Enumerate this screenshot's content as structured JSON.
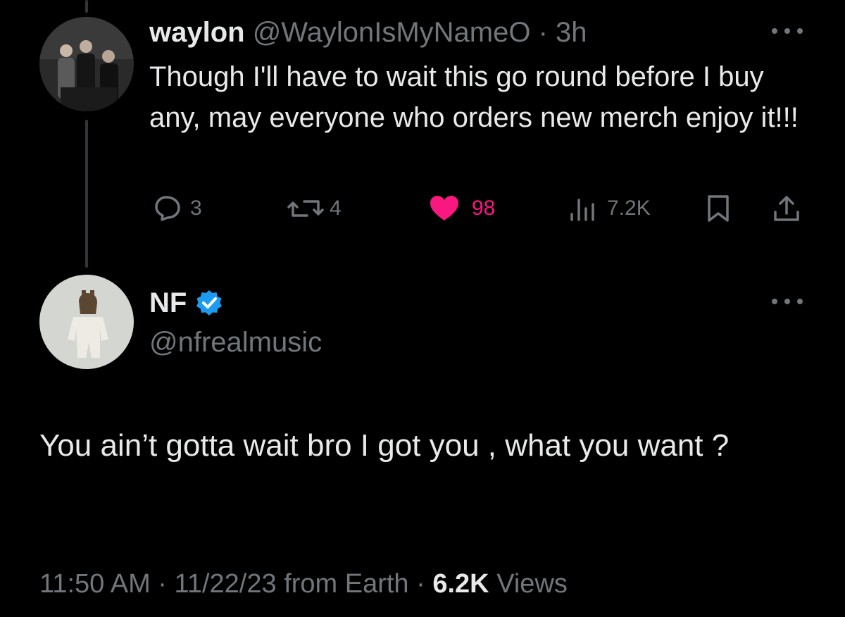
{
  "reply_to": {
    "display_name": "waylon",
    "handle": "@WaylonIsMyNameO",
    "separator": "·",
    "age": "3h",
    "text": "Though I'll have to wait this go round before I buy any, may everyone who orders new merch enjoy it!!!",
    "actions": {
      "replies": "3",
      "reposts": "4",
      "likes": "98",
      "views": "7.2K"
    },
    "like_color": "#f91880"
  },
  "main_tweet": {
    "display_name": "NF",
    "verified": true,
    "verified_color": "#1d9bf0",
    "handle": "@nfrealmusic",
    "text": "You ain’t gotta wait bro I got you , what you want ?",
    "time": "11:50 AM",
    "date": "11/22/23",
    "source": "from Earth",
    "views_count": "6.2K",
    "views_label": "Views"
  },
  "icons": [
    "more-icon",
    "reply-icon",
    "repost-icon",
    "like-icon",
    "views-icon",
    "bookmark-icon",
    "share-icon",
    "verified-badge-icon"
  ]
}
